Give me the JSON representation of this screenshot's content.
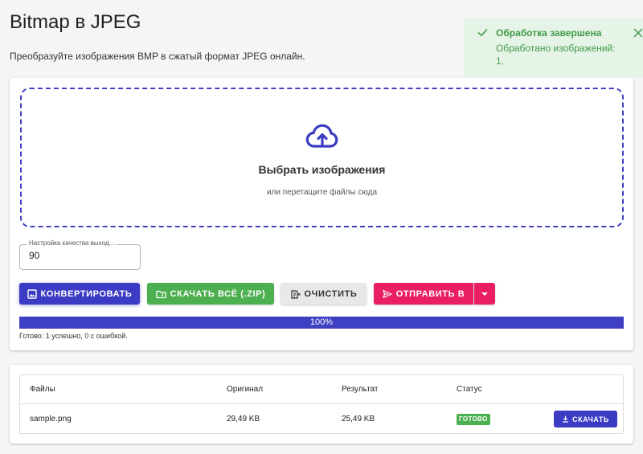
{
  "page": {
    "title": "Bitmap в JPEG",
    "subtitle": "Преобразуйте изображения BMP в сжатый формат JPEG онлайн."
  },
  "dropzone": {
    "icon": "cloud-upload-icon",
    "title": "Выбрать изображения",
    "subtitle": "или перетащите файлы сюда"
  },
  "quality": {
    "label": "Настройка качества выход...",
    "value": "90"
  },
  "actions": {
    "convert_label": "КОНВЕРТИРОВАТЬ",
    "zip_label": "СКАЧАТЬ ВСЁ (.ZIP)",
    "clear_label": "ОЧИСТИТЬ",
    "send_label": "ОТПРАВИТЬ В"
  },
  "progress": {
    "value": 100,
    "label": "100%",
    "status": "Готово: 1 успешно, 0 с ошибкой."
  },
  "table": {
    "headers": [
      "Файлы",
      "Оригинал",
      "Результат",
      "Статус"
    ],
    "rows": [
      {
        "file": "sample.png",
        "original": "29,49 KB",
        "result": "25,49 KB",
        "status": "ГОТОВО",
        "action_label": "СКАЧАТЬ"
      }
    ]
  },
  "toast": {
    "title": "Обработка завершена",
    "message": "Обработано изображений: 1."
  },
  "colors": {
    "primary": "#3b3bc4",
    "success": "#4caf50",
    "danger": "#e91e63",
    "toast_bg": "#e6f4e7",
    "toast_text": "#3f9a46"
  }
}
